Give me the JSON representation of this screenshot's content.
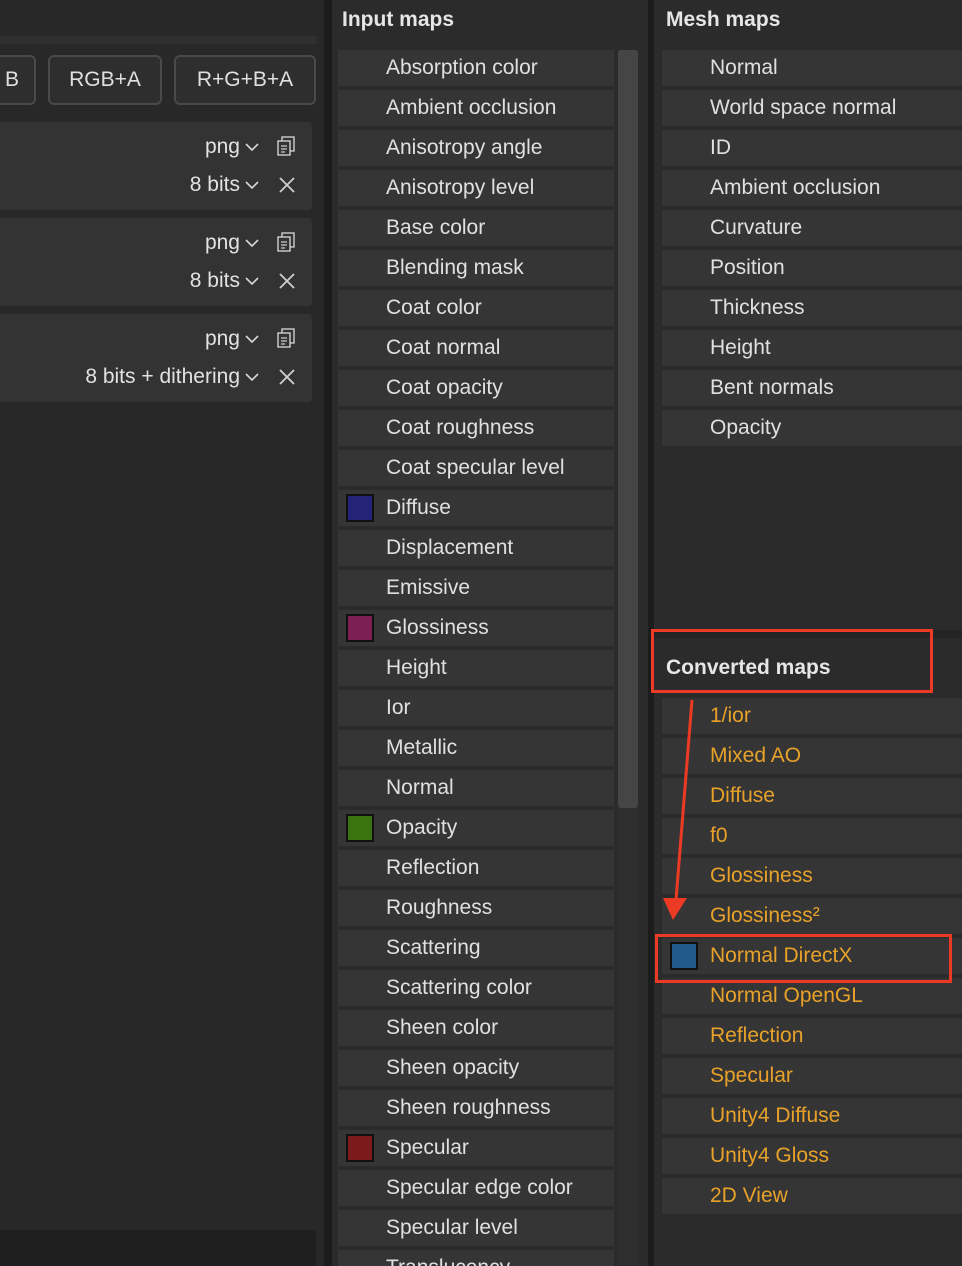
{
  "channel_buttons": [
    "B",
    "RGB+A",
    "R+G+B+A"
  ],
  "outputs": [
    {
      "format": "png",
      "bits": "8 bits"
    },
    {
      "format": "png",
      "bits": "8 bits"
    },
    {
      "format": "png",
      "bits": "8 bits + dithering"
    }
  ],
  "input_maps": {
    "title": "Input maps",
    "items": [
      {
        "label": "Absorption color",
        "swatch": ""
      },
      {
        "label": "Ambient occlusion",
        "swatch": ""
      },
      {
        "label": "Anisotropy angle",
        "swatch": ""
      },
      {
        "label": "Anisotropy level",
        "swatch": ""
      },
      {
        "label": "Base color",
        "swatch": ""
      },
      {
        "label": "Blending mask",
        "swatch": ""
      },
      {
        "label": "Coat color",
        "swatch": ""
      },
      {
        "label": "Coat normal",
        "swatch": ""
      },
      {
        "label": "Coat opacity",
        "swatch": ""
      },
      {
        "label": "Coat roughness",
        "swatch": ""
      },
      {
        "label": "Coat specular level",
        "swatch": ""
      },
      {
        "label": "Diffuse",
        "swatch": "#23237a"
      },
      {
        "label": "Displacement",
        "swatch": ""
      },
      {
        "label": "Emissive",
        "swatch": ""
      },
      {
        "label": "Glossiness",
        "swatch": "#7d1f55"
      },
      {
        "label": "Height",
        "swatch": ""
      },
      {
        "label": "Ior",
        "swatch": ""
      },
      {
        "label": "Metallic",
        "swatch": ""
      },
      {
        "label": "Normal",
        "swatch": ""
      },
      {
        "label": "Opacity",
        "swatch": "#3a7410"
      },
      {
        "label": "Reflection",
        "swatch": ""
      },
      {
        "label": "Roughness",
        "swatch": ""
      },
      {
        "label": "Scattering",
        "swatch": ""
      },
      {
        "label": "Scattering color",
        "swatch": ""
      },
      {
        "label": "Sheen color",
        "swatch": ""
      },
      {
        "label": "Sheen opacity",
        "swatch": ""
      },
      {
        "label": "Sheen roughness",
        "swatch": ""
      },
      {
        "label": "Specular",
        "swatch": "#7a1a1a"
      },
      {
        "label": "Specular edge color",
        "swatch": ""
      },
      {
        "label": "Specular level",
        "swatch": ""
      },
      {
        "label": "Translucency",
        "swatch": ""
      }
    ]
  },
  "mesh_maps": {
    "title": "Mesh maps",
    "items": [
      {
        "label": "Normal",
        "swatch": ""
      },
      {
        "label": "World space normal",
        "swatch": ""
      },
      {
        "label": "ID",
        "swatch": ""
      },
      {
        "label": "Ambient occlusion",
        "swatch": ""
      },
      {
        "label": "Curvature",
        "swatch": ""
      },
      {
        "label": "Position",
        "swatch": ""
      },
      {
        "label": "Thickness",
        "swatch": ""
      },
      {
        "label": "Height",
        "swatch": ""
      },
      {
        "label": "Bent normals",
        "swatch": ""
      },
      {
        "label": "Opacity",
        "swatch": ""
      }
    ]
  },
  "converted_maps": {
    "title": "Converted maps",
    "items": [
      {
        "label": "1/ior",
        "swatch": ""
      },
      {
        "label": "Mixed AO",
        "swatch": ""
      },
      {
        "label": "Diffuse",
        "swatch": ""
      },
      {
        "label": "f0",
        "swatch": ""
      },
      {
        "label": "Glossiness",
        "swatch": ""
      },
      {
        "label": "Glossiness²",
        "swatch": ""
      },
      {
        "label": "Normal DirectX",
        "swatch": "#1f5a8a"
      },
      {
        "label": "Normal OpenGL",
        "swatch": ""
      },
      {
        "label": "Reflection",
        "swatch": ""
      },
      {
        "label": "Specular",
        "swatch": ""
      },
      {
        "label": "Unity4 Diffuse",
        "swatch": ""
      },
      {
        "label": "Unity4 Gloss",
        "swatch": ""
      },
      {
        "label": "2D View",
        "swatch": ""
      }
    ]
  },
  "colors": {
    "converted_text": "#e8a22a",
    "highlight": "#ec3a24"
  }
}
